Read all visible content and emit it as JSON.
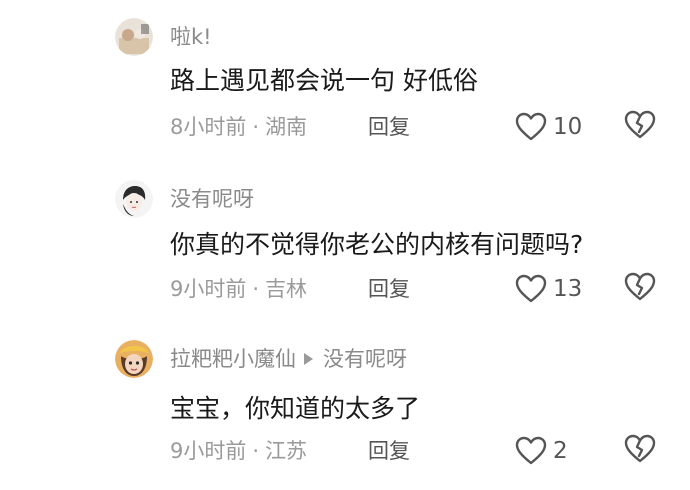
{
  "comments": [
    {
      "username": "啦k!",
      "text": "路上遇见都会说一句 好低俗",
      "time": "8小时前",
      "location": "湖南",
      "separator": "·",
      "reply_label": "回复",
      "likes": "10",
      "icons": {
        "like": "heart-outline-icon",
        "dislike": "broken-heart-icon"
      }
    },
    {
      "username": "没有呢呀",
      "text": "你真的不觉得你老公的内核有问题吗?",
      "time": "9小时前",
      "location": "吉林",
      "separator": "·",
      "reply_label": "回复",
      "likes": "13",
      "icons": {
        "like": "heart-outline-icon",
        "dislike": "broken-heart-icon"
      }
    },
    {
      "username": "拉粑粑小魔仙",
      "reply_to": "没有呢呀",
      "text": "宝宝，你知道的太多了",
      "time": "9小时前",
      "location": "江苏",
      "separator": "·",
      "reply_label": "回复",
      "likes": "2",
      "icons": {
        "like": "heart-outline-icon",
        "dislike": "broken-heart-icon",
        "reply_arrow": "play-arrow-icon"
      }
    }
  ]
}
